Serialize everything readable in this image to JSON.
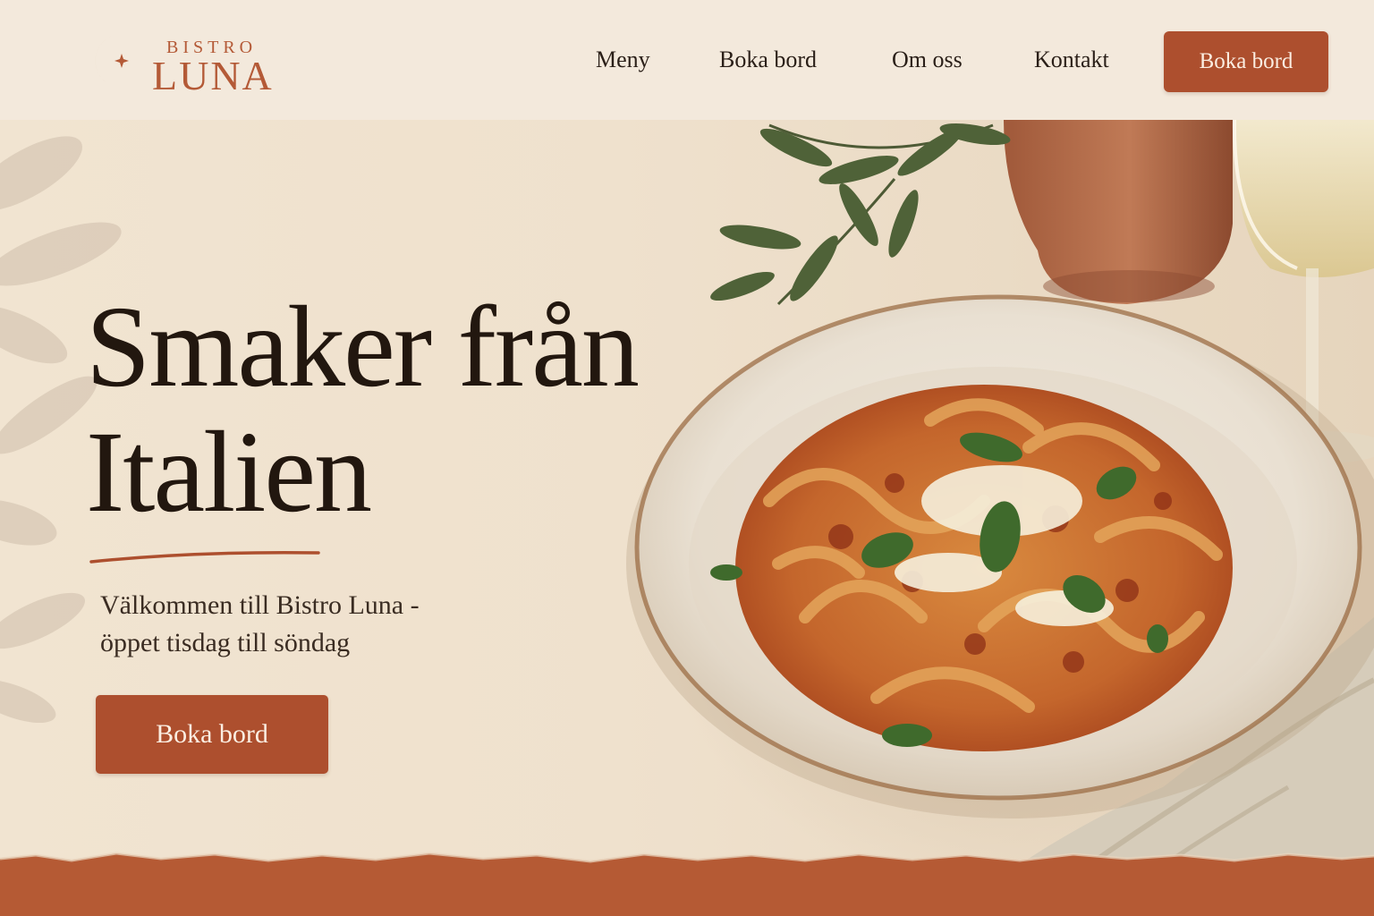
{
  "brand": {
    "small": "BISTRO",
    "name": "LUNA"
  },
  "nav": {
    "items": [
      {
        "label": "Meny"
      },
      {
        "label": "Boka bord"
      },
      {
        "label": "Om oss"
      },
      {
        "label": "Kontakt"
      }
    ],
    "cta_label": "Boka bord"
  },
  "hero": {
    "headline_line1": "Smaker från",
    "headline_line2": "Italien",
    "tagline_line1": "Välkommen till Bistro Luna -",
    "tagline_line2": "öppet tisdag till söndag",
    "cta_label": "Boka bord"
  },
  "colors": {
    "accent": "#ad4f2e",
    "background": "#efe3d1",
    "header_bg": "#f3e9dc",
    "text_dark": "#22170f"
  },
  "icons": {
    "logo": "crescent-moon-star-icon"
  }
}
